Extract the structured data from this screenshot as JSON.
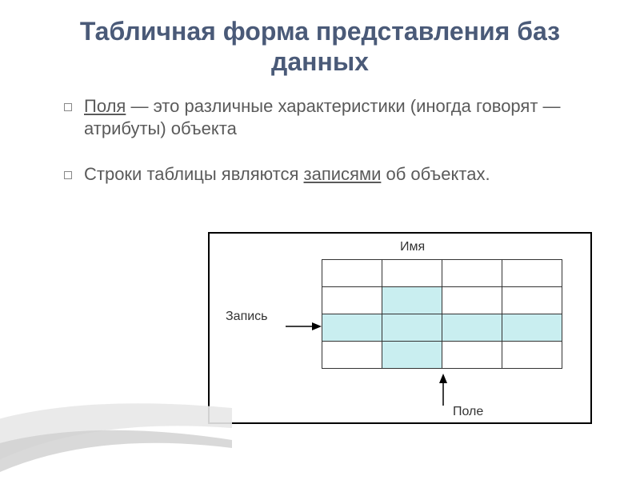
{
  "title": "Табличная форма представления баз данных",
  "bullets": [
    {
      "term": "Поля",
      "dash": " — ",
      "rest": "это различные характеристики (иногда говорят — атрибуты) объекта"
    },
    {
      "start": "Строки таблицы являются ",
      "term": "записями",
      "end": " об объектах."
    }
  ],
  "labels": {
    "top": "Имя",
    "left": "Запись",
    "bottom": "Поле"
  }
}
